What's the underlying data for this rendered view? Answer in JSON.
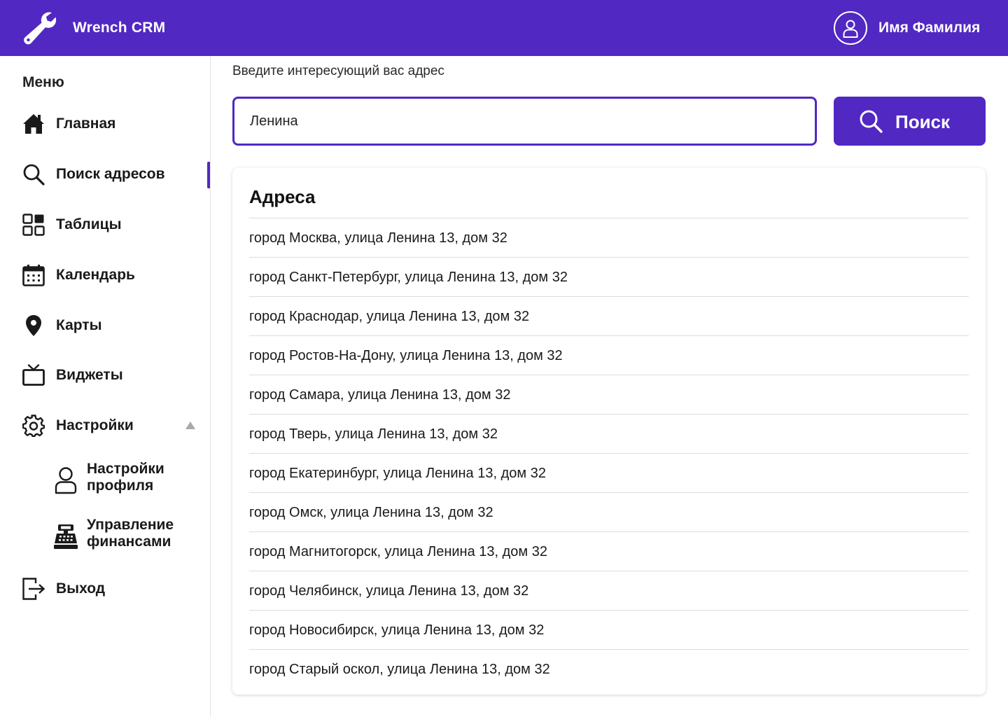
{
  "header": {
    "app_title": "Wrench CRM",
    "logo_icon": "wrench-icon",
    "user_icon": "user-icon",
    "user_name": "Имя Фамилия",
    "brand_color": "#5128c2"
  },
  "sidebar": {
    "title": "Меню",
    "items": [
      {
        "label": "Главная",
        "icon": "home-icon"
      },
      {
        "label": "Поиск адресов",
        "icon": "search-icon",
        "active": true
      },
      {
        "label": "Таблицы",
        "icon": "tables-icon"
      },
      {
        "label": "Календарь",
        "icon": "calendar-icon"
      },
      {
        "label": "Карты",
        "icon": "map-pin-icon"
      },
      {
        "label": "Виджеты",
        "icon": "tv-icon"
      },
      {
        "label": "Настройки",
        "icon": "gear-icon",
        "expanded": true
      },
      {
        "label": "Выход",
        "icon": "logout-icon"
      }
    ],
    "settings_caret_icon": "caret-up-icon",
    "sub_items": [
      {
        "label": "Настройки профиля",
        "icon": "profile-icon"
      },
      {
        "label": "Управление финансами",
        "icon": "cash-register-icon"
      }
    ]
  },
  "search": {
    "caption": "Введите интересующий вас адрес",
    "value": "Ленина",
    "button_label": "Поиск",
    "button_icon": "search-icon"
  },
  "results": {
    "title": "Адреса",
    "addresses": [
      "город Москва, улица Ленина 13, дом 32",
      "город Санкт-Петербург, улица Ленина 13, дом 32",
      "город Краснодар, улица Ленина 13, дом 32",
      "город Ростов-На-Дону, улица Ленина 13, дом 32",
      "город Самара, улица Ленина 13, дом 32",
      "город Тверь, улица Ленина 13, дом 32",
      "город Екатеринбург, улица Ленина 13, дом 32",
      "город Омск, улица Ленина 13, дом 32",
      "город Магнитогорск, улица Ленина 13, дом 32",
      "город Челябинск, улица Ленина 13, дом 32",
      "город Новосибирск, улица Ленина 13, дом 32",
      "город Старый оскол, улица Ленина 13, дом 32"
    ]
  }
}
